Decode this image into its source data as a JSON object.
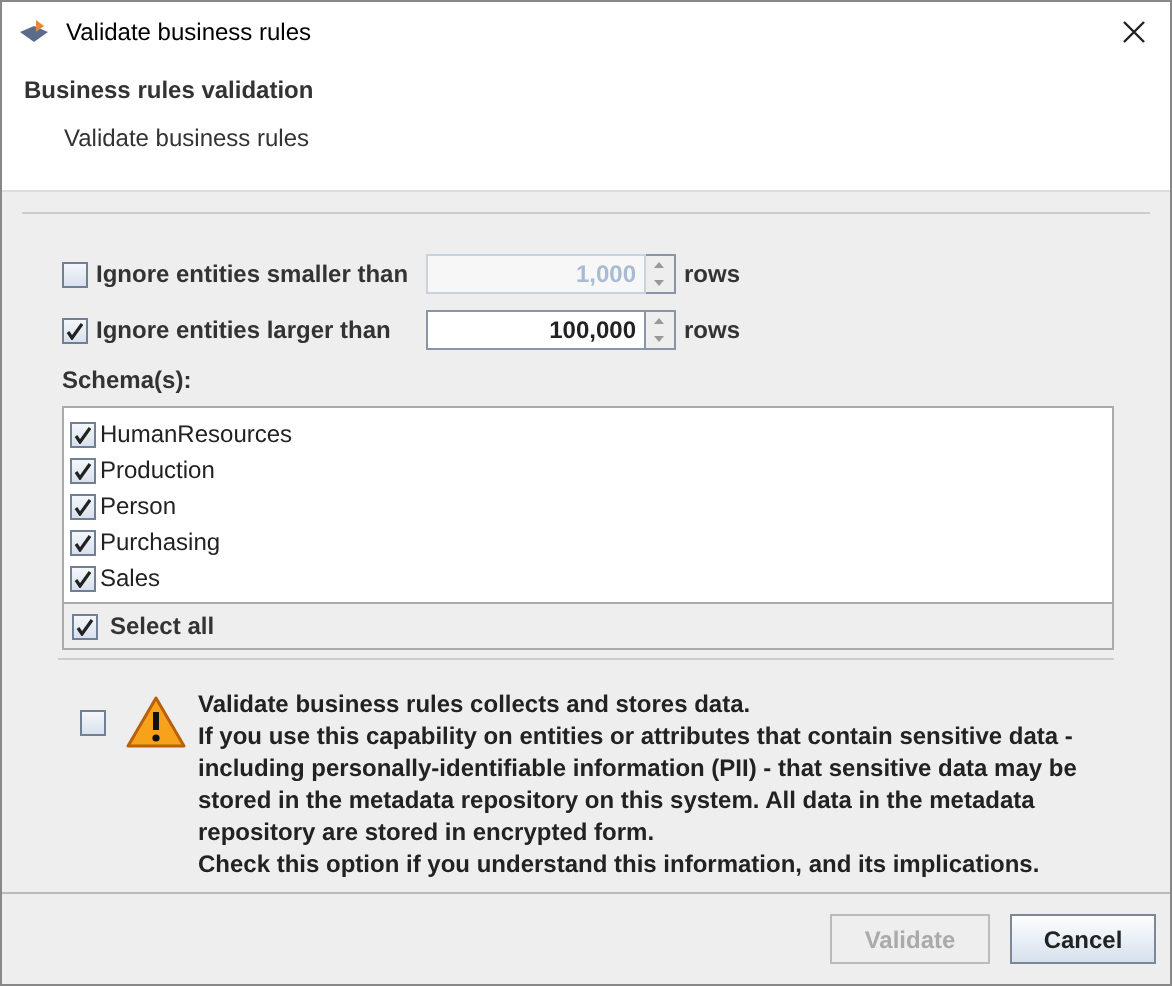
{
  "window": {
    "title": "Validate business rules"
  },
  "header": {
    "title": "Business rules validation",
    "subtitle": "Validate business rules"
  },
  "limits": [
    {
      "label": "Ignore entities smaller than",
      "checked": false,
      "value": "1,000",
      "unit": "rows",
      "disabled": true
    },
    {
      "label": "Ignore entities larger than",
      "checked": true,
      "value": "100,000",
      "unit": "rows",
      "disabled": false
    }
  ],
  "schemas": {
    "label": "Schema(s):",
    "items": [
      {
        "name": "HumanResources",
        "checked": true
      },
      {
        "name": "Production",
        "checked": true
      },
      {
        "name": "Person",
        "checked": true
      },
      {
        "name": "Purchasing",
        "checked": true
      },
      {
        "name": "Sales",
        "checked": true
      }
    ],
    "select_all": {
      "label": "Select all",
      "checked": true
    }
  },
  "consent": {
    "checked": false,
    "lines": [
      "Validate business rules collects and stores data.",
      "If you use this capability on entities or attributes that contain sensitive data -",
      "including personally-identifiable information (PII) - that sensitive data may be",
      "stored in the metadata repository on this system. All data in the metadata",
      "repository are stored in encrypted form.",
      "Check this option if you understand this information, and its implications."
    ]
  },
  "buttons": [
    {
      "label": "Validate",
      "kind": "primary",
      "disabled": true
    },
    {
      "label": "Cancel",
      "kind": "secondary",
      "disabled": false
    }
  ]
}
